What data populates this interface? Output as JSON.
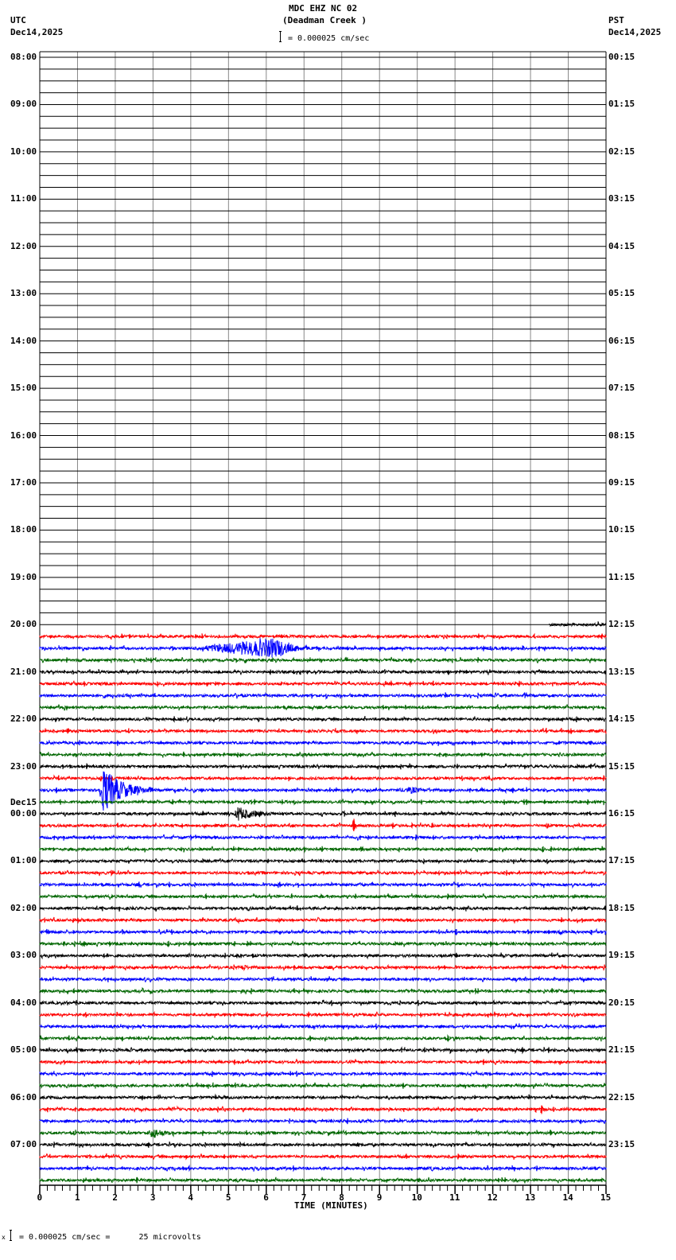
{
  "header": {
    "title": "MDC EHZ NC 02",
    "subtitle": "(Deadman Creek )",
    "scale_text": "= 0.000025 cm/sec",
    "left_tz": "UTC",
    "left_date": "Dec14,2025",
    "right_tz": "PST",
    "right_date": "Dec14,2025"
  },
  "footer": {
    "scale_text": "= 0.000025 cm/sec =      25 microvolts",
    "mark": "x"
  },
  "chart_data": {
    "type": "line",
    "title": "MDC EHZ NC 02 (Deadman Creek )",
    "xlabel": "TIME (MINUTES)",
    "xlim": [
      0,
      15
    ],
    "x_ticks": [
      "0",
      "1",
      "2",
      "3",
      "4",
      "5",
      "6",
      "7",
      "8",
      "9",
      "10",
      "11",
      "12",
      "13",
      "14",
      "15"
    ],
    "rows_per_hour": 4,
    "row_minutes": 15,
    "utc_labels": [
      "08:00",
      "09:00",
      "10:00",
      "11:00",
      "12:00",
      "13:00",
      "14:00",
      "15:00",
      "16:00",
      "17:00",
      "18:00",
      "19:00",
      "20:00",
      "21:00",
      "22:00",
      "23:00",
      "00:00",
      "01:00",
      "02:00",
      "03:00",
      "04:00",
      "05:00",
      "06:00",
      "07:00"
    ],
    "date_change_label": {
      "text": "Dec15",
      "before_hour": "00:00"
    },
    "pst_labels": [
      "00:15",
      "01:15",
      "02:15",
      "03:15",
      "04:15",
      "05:15",
      "06:15",
      "07:15",
      "08:15",
      "09:15",
      "10:15",
      "11:15",
      "12:15",
      "13:15",
      "14:15",
      "15:15",
      "16:15",
      "17:15",
      "18:15",
      "19:15",
      "20:15",
      "21:15",
      "22:15",
      "23:15"
    ],
    "total_rows": 96,
    "data_start": {
      "row": 48,
      "minute": 13.5
    },
    "trace_colors": [
      "#000000",
      "#ff0000",
      "#0000ff",
      "#006600"
    ],
    "noise_amplitude": 1.6,
    "events": [
      {
        "row": 50,
        "start": 4.0,
        "peak": 6.3,
        "end": 7.2,
        "amplitude": 11
      },
      {
        "row": 62,
        "start": 1.55,
        "peak": 1.7,
        "end": 3.0,
        "amplitude": 28
      },
      {
        "row": 62,
        "start": 9.4,
        "peak": 9.9,
        "end": 10.4,
        "amplitude": 2.5
      },
      {
        "row": 64,
        "start": 5.15,
        "peak": 5.25,
        "end": 6.3,
        "amplitude": 8
      },
      {
        "row": 65,
        "start": 8.28,
        "peak": 8.32,
        "end": 8.4,
        "amplitude": 10
      },
      {
        "row": 65,
        "start": 13.4,
        "peak": 13.45,
        "end": 13.55,
        "amplitude": 3
      },
      {
        "row": 74,
        "start": 13.7,
        "peak": 13.8,
        "end": 13.95,
        "amplitude": 3
      },
      {
        "row": 77,
        "start": 5.3,
        "peak": 5.4,
        "end": 5.6,
        "amplitude": 3
      },
      {
        "row": 89,
        "start": 13.25,
        "peak": 13.3,
        "end": 13.4,
        "amplitude": 7
      },
      {
        "row": 91,
        "start": 2.85,
        "peak": 3.0,
        "end": 3.7,
        "amplitude": 6
      }
    ]
  }
}
